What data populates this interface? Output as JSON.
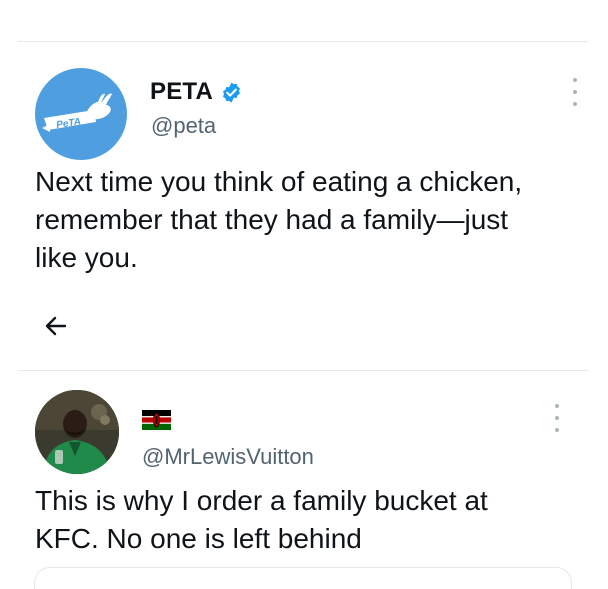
{
  "tweet1": {
    "avatar": {
      "logo_text": "PeTA",
      "background": "#4f9fe0"
    },
    "display_name": "PETA",
    "verified_color": "#1d9bf0",
    "handle": "@peta",
    "text_lines": [
      "Next time you think of eating a chicken,",
      "remember that they had a family—just",
      "like you."
    ]
  },
  "nav": {
    "back_icon": "arrow-left-icon"
  },
  "tweet2": {
    "flag": "kenya-flag-icon",
    "handle": "@MrLewisVuitton",
    "text_lines": [
      "This is why I order a family bucket at",
      "KFC. No one is left behind"
    ]
  },
  "colors": {
    "text_primary": "#0f1419",
    "text_secondary": "#536471",
    "divider": "#e6e9eb"
  }
}
